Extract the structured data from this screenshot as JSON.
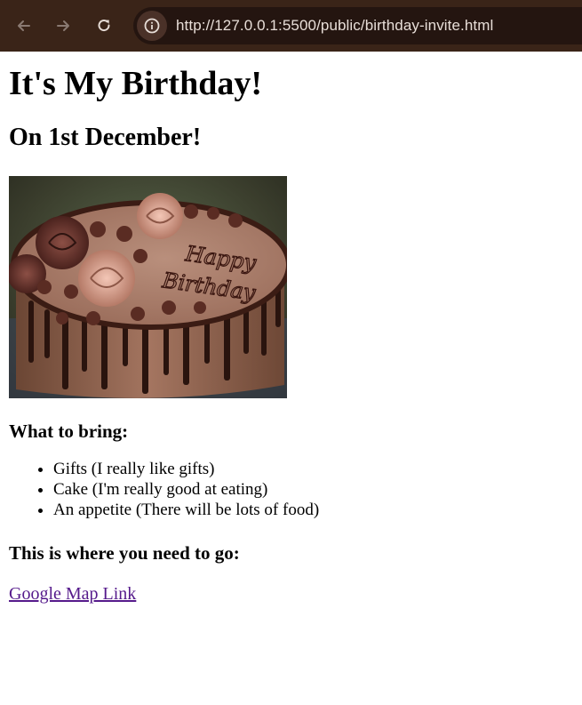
{
  "browser": {
    "url": "http://127.0.0.1:5500/public/birthday-invite.html",
    "back_icon": "arrow-left-icon",
    "forward_icon": "arrow-right-icon",
    "reload_icon": "reload-icon",
    "info_icon": "info-icon"
  },
  "page": {
    "title": "It's My Birthday!",
    "subtitle": "On 1st December!",
    "image": {
      "cake_text_line1": "Happy",
      "cake_text_line2": "Birthday"
    },
    "bring_heading": "What to bring:",
    "bring_items": [
      "Gifts (I really like gifts)",
      "Cake (I'm really good at eating)",
      "An appetite (There will be lots of food)"
    ],
    "go_heading": "This is where you need to go:",
    "map_link": "Google Map Link"
  },
  "colors": {
    "chrome": "#3a2418",
    "omnibox": "#241510",
    "visited_link": "#551a8b"
  }
}
